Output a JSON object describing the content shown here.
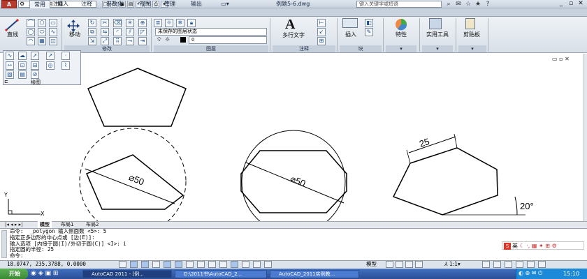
{
  "titlebar": {
    "app_button": "A",
    "workspace": "二维草图与注释",
    "file_title": "例题5-6.dwg",
    "search_placeholder": "键入关键字或短语",
    "quick_access": [
      "new-icon",
      "open-icon",
      "save-icon",
      "undo-icon",
      "redo-icon",
      "plot-icon"
    ]
  },
  "ribbon_tabs": [
    "常用",
    "插入",
    "注释",
    "参数化",
    "视图",
    "管理",
    "输出"
  ],
  "ribbon": {
    "draw": {
      "line_label": "直线",
      "title": "绘图"
    },
    "modify": {
      "move_label": "移动",
      "title": "修改"
    },
    "layers": {
      "layer_state": "未保存的图层状态",
      "current_layer": "0",
      "title": "图层"
    },
    "annotation": {
      "mtext_label": "多行文字",
      "title": "注释"
    },
    "block": {
      "insert_label": "插入",
      "title": "块"
    },
    "properties_label": "特性",
    "utilities_label": "实用工具",
    "clipboard_label": "剪贴板"
  },
  "drawing": {
    "dim_diameter_1": "⌀50",
    "dim_diameter_2": "⌀50",
    "dim_length": "25",
    "dim_angle": "20°",
    "ucs_y": "Y",
    "ucs_x": "X"
  },
  "layout_tabs": [
    "模型",
    "布局1",
    "布局2"
  ],
  "command_lines": [
    "命令:  _polygon 输入侧面数 <5>: 5",
    "指定正多边形的中心点或 [边(E)]:",
    "输入选项 [内接于圆(I)/外切于圆(C)] <I>: i",
    "指定圆的半径: 25",
    "命令:"
  ],
  "status": {
    "coords": "18.0747,  235.3788, 0.0000",
    "model_label": "模型",
    "scale": "1:1",
    "ime_label": "英"
  },
  "taskbar": {
    "start_label": "开始",
    "tasks": [
      "AutoCAD 2011 - [例...",
      "D:\\2011书\\AutoCAD_2...",
      "AutoCAD_2011实例教..."
    ],
    "clock": "15:10"
  }
}
